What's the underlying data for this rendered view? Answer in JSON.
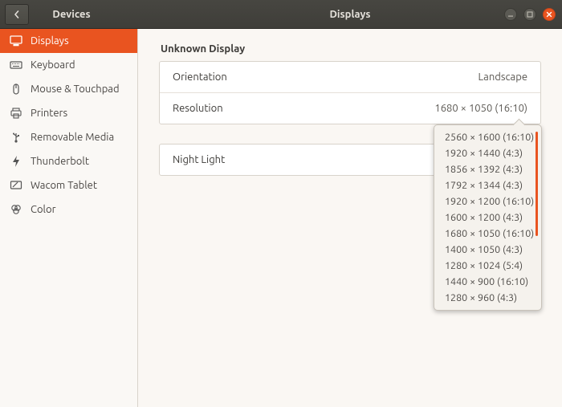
{
  "titlebar": {
    "left_title": "Devices",
    "center_title": "Displays"
  },
  "sidebar": {
    "items": [
      {
        "key": "displays",
        "label": "Displays",
        "active": true
      },
      {
        "key": "keyboard",
        "label": "Keyboard",
        "active": false
      },
      {
        "key": "mouse",
        "label": "Mouse & Touchpad",
        "active": false
      },
      {
        "key": "printers",
        "label": "Printers",
        "active": false
      },
      {
        "key": "removable",
        "label": "Removable Media",
        "active": false
      },
      {
        "key": "thunderbolt",
        "label": "Thunderbolt",
        "active": false
      },
      {
        "key": "wacom",
        "label": "Wacom Tablet",
        "active": false
      },
      {
        "key": "color",
        "label": "Color",
        "active": false
      }
    ]
  },
  "content": {
    "section_heading": "Unknown Display",
    "rows": {
      "orientation": {
        "label": "Orientation",
        "value": "Landscape"
      },
      "resolution": {
        "label": "Resolution",
        "value": "1680 × 1050 (16:10)"
      }
    },
    "nightlight": {
      "label": "Night Light",
      "value": ""
    }
  },
  "dropdown": {
    "options": [
      "2560 × 1600 (16:10)",
      "1920 × 1440 (4:3)",
      "1856 × 1392 (4:3)",
      "1792 × 1344 (4:3)",
      "1920 × 1200 (16:10)",
      "1600 × 1200 (4:3)",
      "1680 × 1050 (16:10)",
      "1400 × 1050 (4:3)",
      "1280 × 1024 (5:4)",
      "1440 × 900 (16:10)",
      "1280 × 960 (4:3)"
    ]
  },
  "colors": {
    "accent": "#e95420"
  }
}
